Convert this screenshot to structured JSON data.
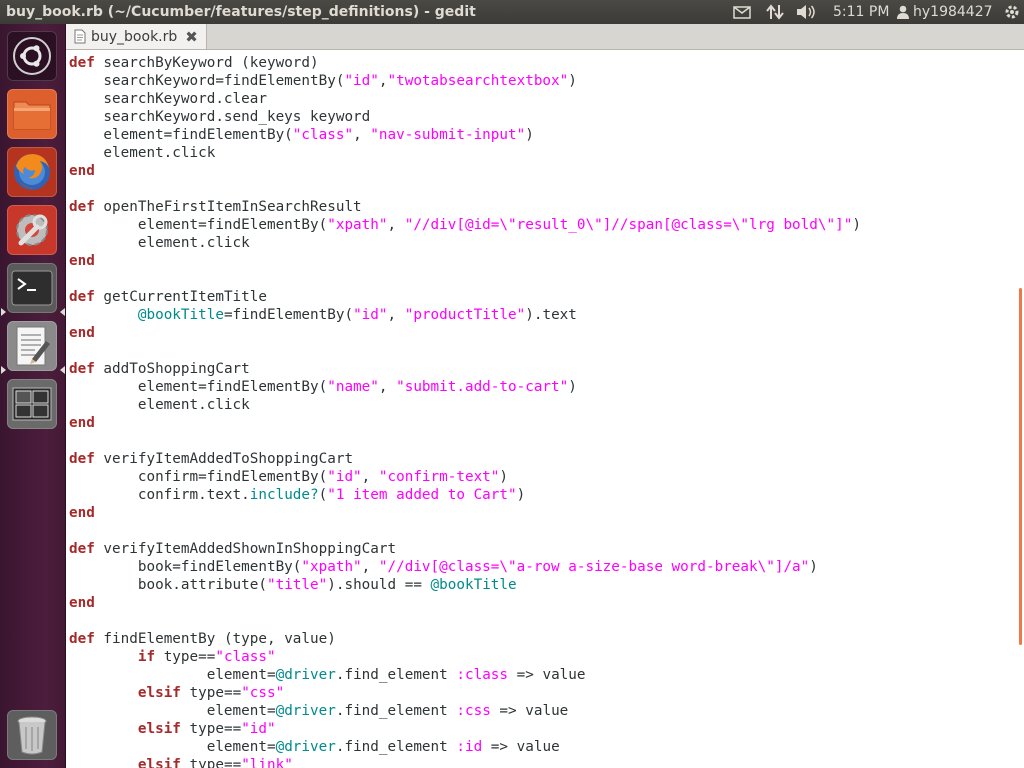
{
  "window": {
    "title": "buy_book.rb (~/Cucumber/features/step_definitions) - gedit"
  },
  "panel": {
    "time": "5:11 PM",
    "user": "hy1984427"
  },
  "launcher": {
    "items": [
      {
        "name": "dash-home",
        "icon": "ubuntu-logo-icon"
      },
      {
        "name": "files",
        "icon": "folder-icon"
      },
      {
        "name": "firefox",
        "icon": "firefox-icon"
      },
      {
        "name": "system-settings",
        "icon": "settings-wrench-icon"
      },
      {
        "name": "terminal",
        "icon": "terminal-icon"
      },
      {
        "name": "gedit",
        "icon": "text-editor-icon"
      },
      {
        "name": "workspace-switcher",
        "icon": "workspace-icon"
      },
      {
        "name": "trash",
        "icon": "trash-icon"
      }
    ]
  },
  "tab": {
    "label": "buy_book.rb"
  },
  "code_lines": [
    [
      [
        "kw",
        "def"
      ],
      [
        "t",
        " searchByKeyword (keyword)"
      ]
    ],
    [
      [
        "t",
        "    searchKeyword=findElementBy("
      ],
      [
        "st",
        "\"id\""
      ],
      [
        "t",
        ","
      ],
      [
        "st",
        "\"twotabsearchtextbox\""
      ],
      [
        "t",
        ")"
      ]
    ],
    [
      [
        "t",
        "    searchKeyword.clear"
      ]
    ],
    [
      [
        "t",
        "    searchKeyword.send_keys keyword"
      ]
    ],
    [
      [
        "t",
        "    element=findElementBy("
      ],
      [
        "st",
        "\"class\""
      ],
      [
        "t",
        ", "
      ],
      [
        "st",
        "\"nav-submit-input\""
      ],
      [
        "t",
        ")"
      ]
    ],
    [
      [
        "t",
        "    element.click"
      ]
    ],
    [
      [
        "kw",
        "end"
      ]
    ],
    [
      [
        "t",
        ""
      ]
    ],
    [
      [
        "kw",
        "def"
      ],
      [
        "t",
        " openTheFirstItemInSearchResult"
      ]
    ],
    [
      [
        "t",
        "        element=findElementBy("
      ],
      [
        "st",
        "\"xpath\""
      ],
      [
        "t",
        ", "
      ],
      [
        "st",
        "\"//div[@id=\\\"result_0\\\"]//span[@class=\\\"lrg bold\\\"]\""
      ],
      [
        "t",
        ")"
      ]
    ],
    [
      [
        "t",
        "        element.click"
      ]
    ],
    [
      [
        "kw",
        "end"
      ]
    ],
    [
      [
        "t",
        ""
      ]
    ],
    [
      [
        "kw",
        "def"
      ],
      [
        "t",
        " getCurrentItemTitle"
      ]
    ],
    [
      [
        "t",
        "        "
      ],
      [
        "iv",
        "@bookTitle"
      ],
      [
        "t",
        "=findElementBy("
      ],
      [
        "st",
        "\"id\""
      ],
      [
        "t",
        ", "
      ],
      [
        "st",
        "\"productTitle\""
      ],
      [
        "t",
        ").text"
      ]
    ],
    [
      [
        "kw",
        "end"
      ]
    ],
    [
      [
        "t",
        ""
      ]
    ],
    [
      [
        "kw",
        "def"
      ],
      [
        "t",
        " addToShoppingCart"
      ]
    ],
    [
      [
        "t",
        "        element=findElementBy("
      ],
      [
        "st",
        "\"name\""
      ],
      [
        "t",
        ", "
      ],
      [
        "st",
        "\"submit.add-to-cart\""
      ],
      [
        "t",
        ")"
      ]
    ],
    [
      [
        "t",
        "        element.click"
      ]
    ],
    [
      [
        "kw",
        "end"
      ]
    ],
    [
      [
        "t",
        ""
      ]
    ],
    [
      [
        "kw",
        "def"
      ],
      [
        "t",
        " verifyItemAddedToShoppingCart"
      ]
    ],
    [
      [
        "t",
        "        confirm=findElementBy("
      ],
      [
        "st",
        "\"id\""
      ],
      [
        "t",
        ", "
      ],
      [
        "st",
        "\"confirm-text\""
      ],
      [
        "t",
        ")"
      ]
    ],
    [
      [
        "t",
        "        confirm.text."
      ],
      [
        "iv",
        "include?"
      ],
      [
        "t",
        "("
      ],
      [
        "st",
        "\"1 item added to Cart\""
      ],
      [
        "t",
        ")"
      ]
    ],
    [
      [
        "kw",
        "end"
      ]
    ],
    [
      [
        "t",
        ""
      ]
    ],
    [
      [
        "kw",
        "def"
      ],
      [
        "t",
        " verifyItemAddedShownInShoppingCart"
      ]
    ],
    [
      [
        "t",
        "        book=findElementBy("
      ],
      [
        "st",
        "\"xpath\""
      ],
      [
        "t",
        ", "
      ],
      [
        "st",
        "\"//div[@class=\\\"a-row a-size-base word-break\\\"]/a\""
      ],
      [
        "t",
        ")"
      ]
    ],
    [
      [
        "t",
        "        book.attribute("
      ],
      [
        "st",
        "\"title\""
      ],
      [
        "t",
        ").should == "
      ],
      [
        "iv",
        "@bookTitle"
      ]
    ],
    [
      [
        "kw",
        "end"
      ]
    ],
    [
      [
        "t",
        ""
      ]
    ],
    [
      [
        "kw",
        "def"
      ],
      [
        "t",
        " findElementBy (type, value)"
      ]
    ],
    [
      [
        "t",
        "        "
      ],
      [
        "kw",
        "if"
      ],
      [
        "t",
        " type=="
      ],
      [
        "st",
        "\"class\""
      ]
    ],
    [
      [
        "t",
        "                element="
      ],
      [
        "iv",
        "@driver"
      ],
      [
        "t",
        ".find_element "
      ],
      [
        "sy",
        ":class"
      ],
      [
        "t",
        " => value"
      ]
    ],
    [
      [
        "t",
        "        "
      ],
      [
        "kw",
        "elsif"
      ],
      [
        "t",
        " type=="
      ],
      [
        "st",
        "\"css\""
      ]
    ],
    [
      [
        "t",
        "                element="
      ],
      [
        "iv",
        "@driver"
      ],
      [
        "t",
        ".find_element "
      ],
      [
        "sy",
        ":css"
      ],
      [
        "t",
        " => value"
      ]
    ],
    [
      [
        "t",
        "        "
      ],
      [
        "kw",
        "elsif"
      ],
      [
        "t",
        " type=="
      ],
      [
        "st",
        "\"id\""
      ]
    ],
    [
      [
        "t",
        "                element="
      ],
      [
        "iv",
        "@driver"
      ],
      [
        "t",
        ".find_element "
      ],
      [
        "sy",
        ":id"
      ],
      [
        "t",
        " => value"
      ]
    ],
    [
      [
        "t",
        "        "
      ],
      [
        "kw",
        "elsif"
      ],
      [
        "t",
        " type=="
      ],
      [
        "st",
        "\"link\""
      ]
    ]
  ],
  "colors": {
    "keyword": "#a52a2a",
    "string": "#ff00ff",
    "instance_variable": "#008a8c",
    "scroll_thumb": "#f07746",
    "launcher_bg": "#4c1d3c"
  }
}
